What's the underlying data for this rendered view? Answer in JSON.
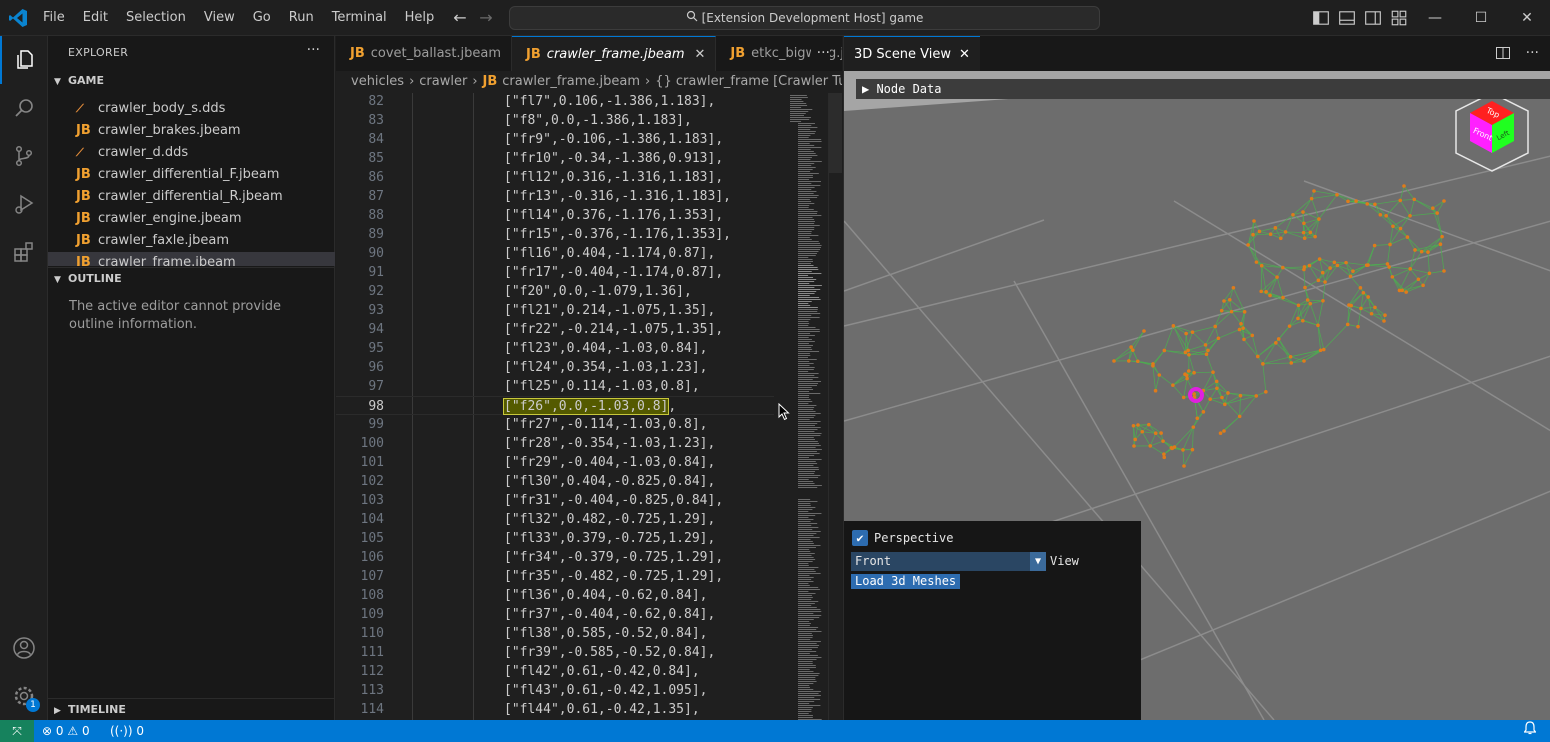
{
  "menu": [
    "File",
    "Edit",
    "Selection",
    "View",
    "Go",
    "Run",
    "Terminal",
    "Help"
  ],
  "command_center": "[Extension Development Host] game",
  "window_controls": {
    "minimize": "—",
    "maximize": "☐",
    "close": "✕"
  },
  "sidebar": {
    "title": "EXPLORER",
    "more": "···",
    "section_game": "GAME",
    "files": [
      {
        "name": "crawler_body_s.dds",
        "icon": "dds"
      },
      {
        "name": "crawler_brakes.jbeam",
        "icon": "JB"
      },
      {
        "name": "crawler_d.dds",
        "icon": "dds"
      },
      {
        "name": "crawler_differential_F.jbeam",
        "icon": "JB"
      },
      {
        "name": "crawler_differential_R.jbeam",
        "icon": "JB"
      },
      {
        "name": "crawler_engine.jbeam",
        "icon": "JB"
      },
      {
        "name": "crawler_faxle.jbeam",
        "icon": "JB"
      },
      {
        "name": "crawler_frame.jbeam",
        "icon": "JB"
      }
    ],
    "section_outline": "OUTLINE",
    "outline_message": "The active editor cannot provide outline information.",
    "section_timeline": "TIMELINE"
  },
  "editor": {
    "tabs": [
      {
        "icon": "JB",
        "label": "covet_ballast.jbeam",
        "active": false
      },
      {
        "icon": "JB",
        "label": "crawler_frame.jbeam",
        "active": true
      },
      {
        "icon": "JB",
        "label": "etkc_bigwing.j",
        "active": false
      }
    ],
    "tab_close": "✕",
    "tabs_more": "···",
    "breadcrumb": {
      "parts": [
        "vehicles",
        "crawler"
      ],
      "file_icon": "JB",
      "file": "crawler_frame.jbeam",
      "symbol": "{} crawler_frame [Crawler Tube Frame]"
    },
    "highlight_line": 98,
    "lines": [
      {
        "n": "82",
        "t": "[\"fl7\",0.106,-1.386,1.183],"
      },
      {
        "n": "83",
        "t": "[\"f8\",0.0,-1.386,1.183],"
      },
      {
        "n": "84",
        "t": "[\"fr9\",-0.106,-1.386,1.183],"
      },
      {
        "n": "85",
        "t": "[\"fr10\",-0.34,-1.386,0.913],"
      },
      {
        "n": "86",
        "t": "[\"fl12\",0.316,-1.316,1.183],"
      },
      {
        "n": "87",
        "t": "[\"fr13\",-0.316,-1.316,1.183],"
      },
      {
        "n": "88",
        "t": "[\"fl14\",0.376,-1.176,1.353],"
      },
      {
        "n": "89",
        "t": "[\"fr15\",-0.376,-1.176,1.353],"
      },
      {
        "n": "90",
        "t": "[\"fl16\",0.404,-1.174,0.87],"
      },
      {
        "n": "91",
        "t": "[\"fr17\",-0.404,-1.174,0.87],"
      },
      {
        "n": "92",
        "t": "[\"f20\",0.0,-1.079,1.36],"
      },
      {
        "n": "93",
        "t": "[\"fl21\",0.214,-1.075,1.35],"
      },
      {
        "n": "94",
        "t": "[\"fr22\",-0.214,-1.075,1.35],"
      },
      {
        "n": "95",
        "t": "[\"fl23\",0.404,-1.03,0.84],"
      },
      {
        "n": "96",
        "t": "[\"fl24\",0.354,-1.03,1.23],"
      },
      {
        "n": "97",
        "t": "[\"fl25\",0.114,-1.03,0.8],"
      },
      {
        "n": "98",
        "t": "[\"f26\",0.0,-1.03,0.8]",
        "tail": ","
      },
      {
        "n": "99",
        "t": "[\"fr27\",-0.114,-1.03,0.8],"
      },
      {
        "n": "100",
        "t": "[\"fr28\",-0.354,-1.03,1.23],"
      },
      {
        "n": "101",
        "t": "[\"fr29\",-0.404,-1.03,0.84],"
      },
      {
        "n": "102",
        "t": "[\"fl30\",0.404,-0.825,0.84],"
      },
      {
        "n": "103",
        "t": "[\"fr31\",-0.404,-0.825,0.84],"
      },
      {
        "n": "104",
        "t": "[\"fl32\",0.482,-0.725,1.29],"
      },
      {
        "n": "105",
        "t": "[\"fl33\",0.379,-0.725,1.29],"
      },
      {
        "n": "106",
        "t": "[\"fr34\",-0.379,-0.725,1.29],"
      },
      {
        "n": "107",
        "t": "[\"fr35\",-0.482,-0.725,1.29],"
      },
      {
        "n": "108",
        "t": "[\"fl36\",0.404,-0.62,0.84],"
      },
      {
        "n": "109",
        "t": "[\"fr37\",-0.404,-0.62,0.84],"
      },
      {
        "n": "110",
        "t": "[\"fl38\",0.585,-0.52,0.84],"
      },
      {
        "n": "111",
        "t": "[\"fr39\",-0.585,-0.52,0.84],"
      },
      {
        "n": "112",
        "t": "[\"fl42\",0.61,-0.42,0.84],"
      },
      {
        "n": "113",
        "t": "[\"fl43\",0.61,-0.42,1.095],"
      },
      {
        "n": "114",
        "t": "[\"fl44\",0.61,-0.42,1.35],"
      }
    ]
  },
  "scene": {
    "tab_label": "3D Scene View",
    "tab_close": "✕",
    "more": "···",
    "node_data_label": "Node Data",
    "cube_faces": {
      "top": "Top",
      "front": "Front",
      "left": "Left"
    },
    "perspective_label": "Perspective",
    "perspective_checked": true,
    "view_value": "Front",
    "view_label": "View",
    "load_meshes_label": "Load 3d Meshes"
  },
  "status": {
    "errors": "0",
    "warnings": "0",
    "ports": "0",
    "settings_badge": "1"
  },
  "colors": {
    "accent": "#0078d4",
    "mesh_green": "#4caf50",
    "node_orange": "#e07b1a",
    "selected_node": "#e020e0"
  }
}
